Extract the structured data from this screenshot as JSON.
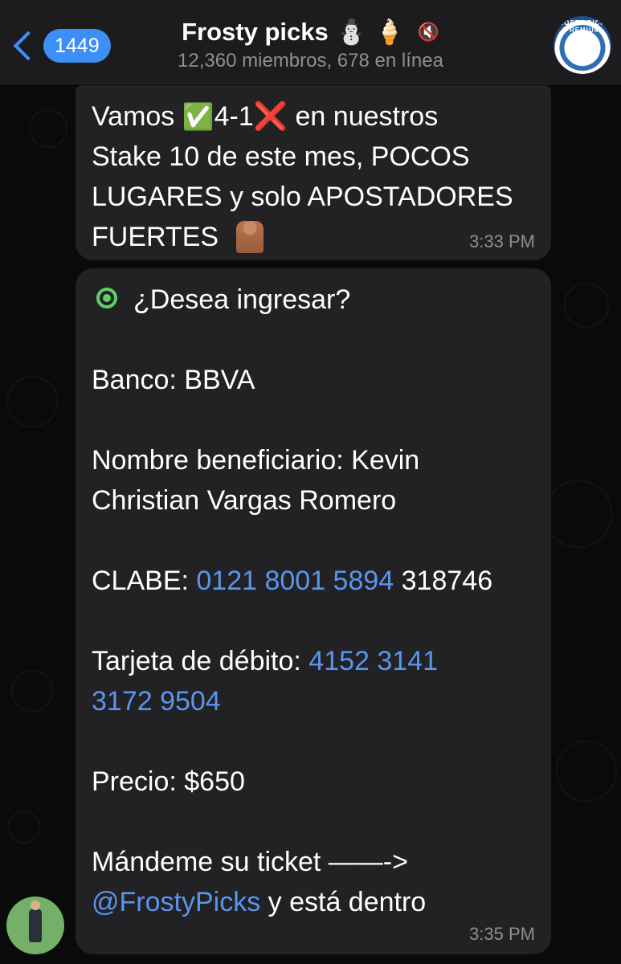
{
  "header": {
    "back_count": "1449",
    "title": "Frosty picks",
    "title_emoji_1": "⛄",
    "title_emoji_2": "🍦",
    "mute_icon": "🔇",
    "subtitle": "12,360 miembros, 678 en línea",
    "avatar_text": "FROSTY PICKS PREMIUM"
  },
  "messages": [
    {
      "part_1": "Vamos ",
      "check": "✅",
      "part_2": "4-1",
      "cross": "❌",
      "part_3": " en nuestros\nStake 10 de este mes, POCOS\nLUGARES y solo APOSTADORES\nFUERTES",
      "time": "3:33 PM"
    },
    {
      "intro": "¿Desea ingresar?",
      "bank": "Banco: BBVA",
      "beneficiary": "Nombre beneficiario: Kevin\nChristian Vargas Romero",
      "clabe_label": "CLABE: ",
      "clabe_link": "0121 8001 5894",
      "clabe_rest": " 318746",
      "card_label": "Tarjeta de débito: ",
      "card_link": "4152 3141\n3172 9504",
      "price": "Precio: $650",
      "ticket": "Mándeme su ticket ——->",
      "mention": "@FrostyPicks",
      "ticket_end": " y está dentro",
      "time": "3:35 PM"
    }
  ]
}
